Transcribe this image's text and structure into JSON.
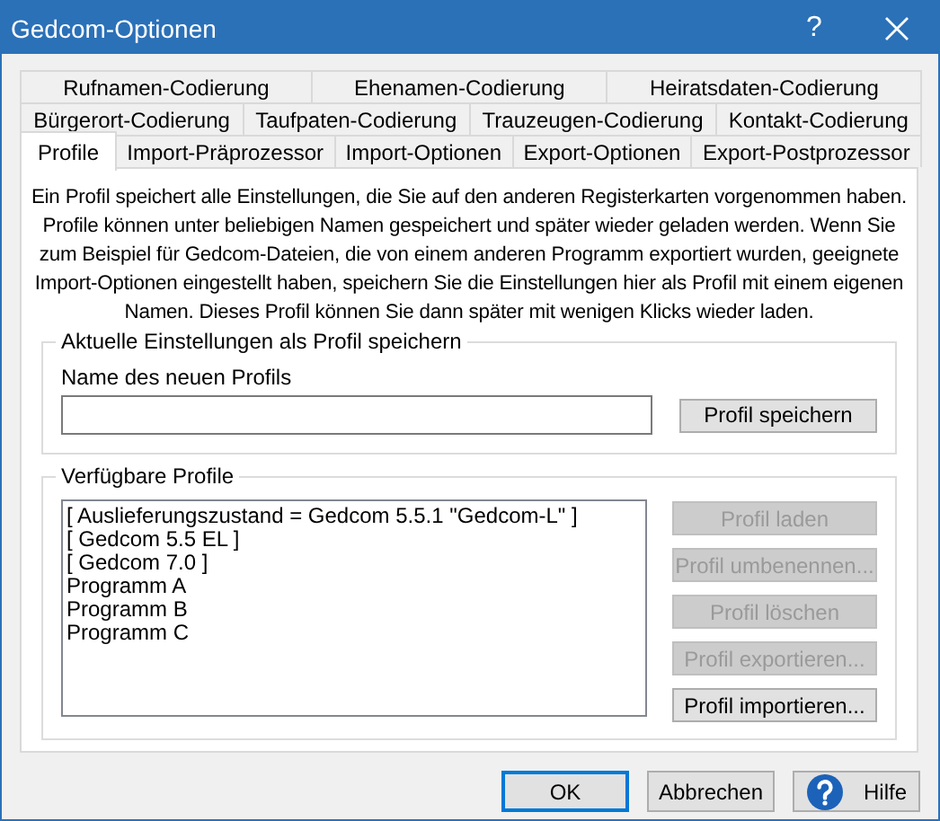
{
  "window": {
    "title": "Gedcom-Optionen",
    "help_glyph": "?"
  },
  "tab_rows": [
    [
      {
        "label": "Rufnamen-Codierung",
        "selected": false
      },
      {
        "label": "Ehenamen-Codierung",
        "selected": false
      },
      {
        "label": "Heiratsdaten-Codierung",
        "selected": false
      }
    ],
    [
      {
        "label": "Bürgerort-Codierung",
        "selected": false
      },
      {
        "label": "Taufpaten-Codierung",
        "selected": false
      },
      {
        "label": "Trauzeugen-Codierung",
        "selected": false
      },
      {
        "label": "Kontakt-Codierung",
        "selected": false
      }
    ],
    [
      {
        "label": "Profile",
        "selected": true
      },
      {
        "label": "Import-Präprozessor",
        "selected": false
      },
      {
        "label": "Import-Optionen",
        "selected": false
      },
      {
        "label": "Export-Optionen",
        "selected": false
      },
      {
        "label": "Export-Postprozessor",
        "selected": false
      }
    ]
  ],
  "description": "Ein Profil speichert alle Einstellungen, die Sie auf den anderen Registerkarten vorgenommen haben. Profile können unter beliebigen Namen gespeichert und später wieder geladen werden. Wenn Sie zum Beispiel für Gedcom-Dateien, die von einem anderen Programm exportiert wurden, geeignete Import-Optionen eingestellt haben, speichern Sie die Einstellungen hier als Profil mit einem eigenen Namen. Dieses Profil können Sie dann später mit wenigen Klicks wieder laden.",
  "save_group": {
    "title": "Aktuelle Einstellungen als Profil speichern",
    "field_label": "Name des neuen Profils",
    "button": {
      "label": "Profil speichern",
      "disabled": false
    }
  },
  "profiles_group": {
    "title": "Verfügbare Profile",
    "items": [
      "[ Auslieferungszustand = Gedcom 5.5.1 \"Gedcom-L\" ]",
      "[ Gedcom 5.5 EL ]",
      "[ Gedcom 7.0 ]",
      "Programm A",
      "Programm B",
      "Programm C"
    ],
    "buttons": [
      {
        "label": "Profil laden",
        "disabled": true
      },
      {
        "label": "Profil umbenennen...",
        "disabled": true
      },
      {
        "label": "Profil löschen",
        "disabled": true
      },
      {
        "label": "Profil exportieren...",
        "disabled": true
      },
      {
        "label": "Profil importieren...",
        "disabled": false
      }
    ]
  },
  "footer_buttons": [
    {
      "label": "OK",
      "kind": "default"
    },
    {
      "label": "Abbrechen",
      "kind": "plain"
    },
    {
      "label": "Hilfe",
      "kind": "help"
    }
  ]
}
